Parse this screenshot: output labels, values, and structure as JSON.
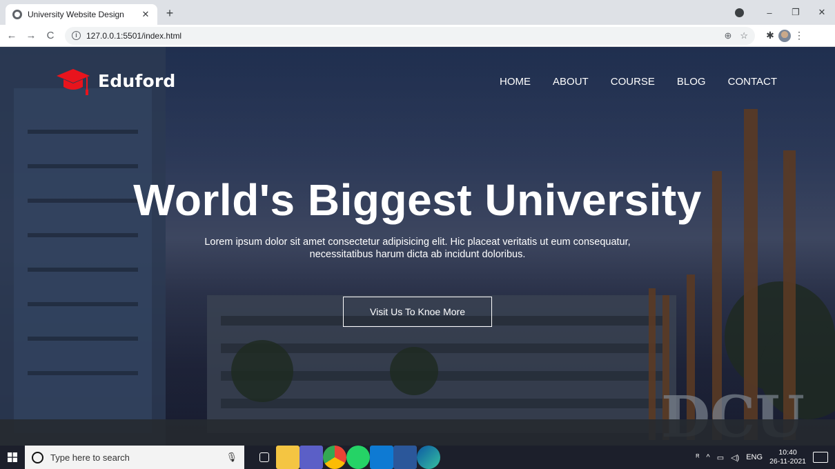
{
  "browser": {
    "tab_title": "University Website Design",
    "tab_close": "✕",
    "new_tab": "+",
    "url": "127.0.0.1:5501/index.html",
    "back": "←",
    "forward": "→",
    "reload": "C",
    "window_controls": [
      "–",
      "❐",
      "✕"
    ]
  },
  "site": {
    "brand": "Eduford",
    "nav": [
      "HOME",
      "ABOUT",
      "COURSE",
      "BLOG",
      "CONTACT"
    ],
    "hero_title": "World's Biggest University",
    "hero_text": "Lorem ipsum dolor sit amet consectetur adipisicing elit. Hic placeat veritatis ut eum consequatur, necessitatibus harum dicta ab incidunt doloribus.",
    "cta_label": "Visit Us To Knoe More",
    "colors": {
      "logo_red": "#e8141d",
      "overlay": "#0c112d",
      "text": "#ffffff"
    }
  },
  "taskbar": {
    "search_placeholder": "Type here to search",
    "language": "ENG",
    "time": "10:40",
    "date": "26-11-2021",
    "apps": [
      "task-view",
      "file-explorer",
      "teams",
      "chrome",
      "whatsapp",
      "vscode",
      "word",
      "edge"
    ]
  }
}
